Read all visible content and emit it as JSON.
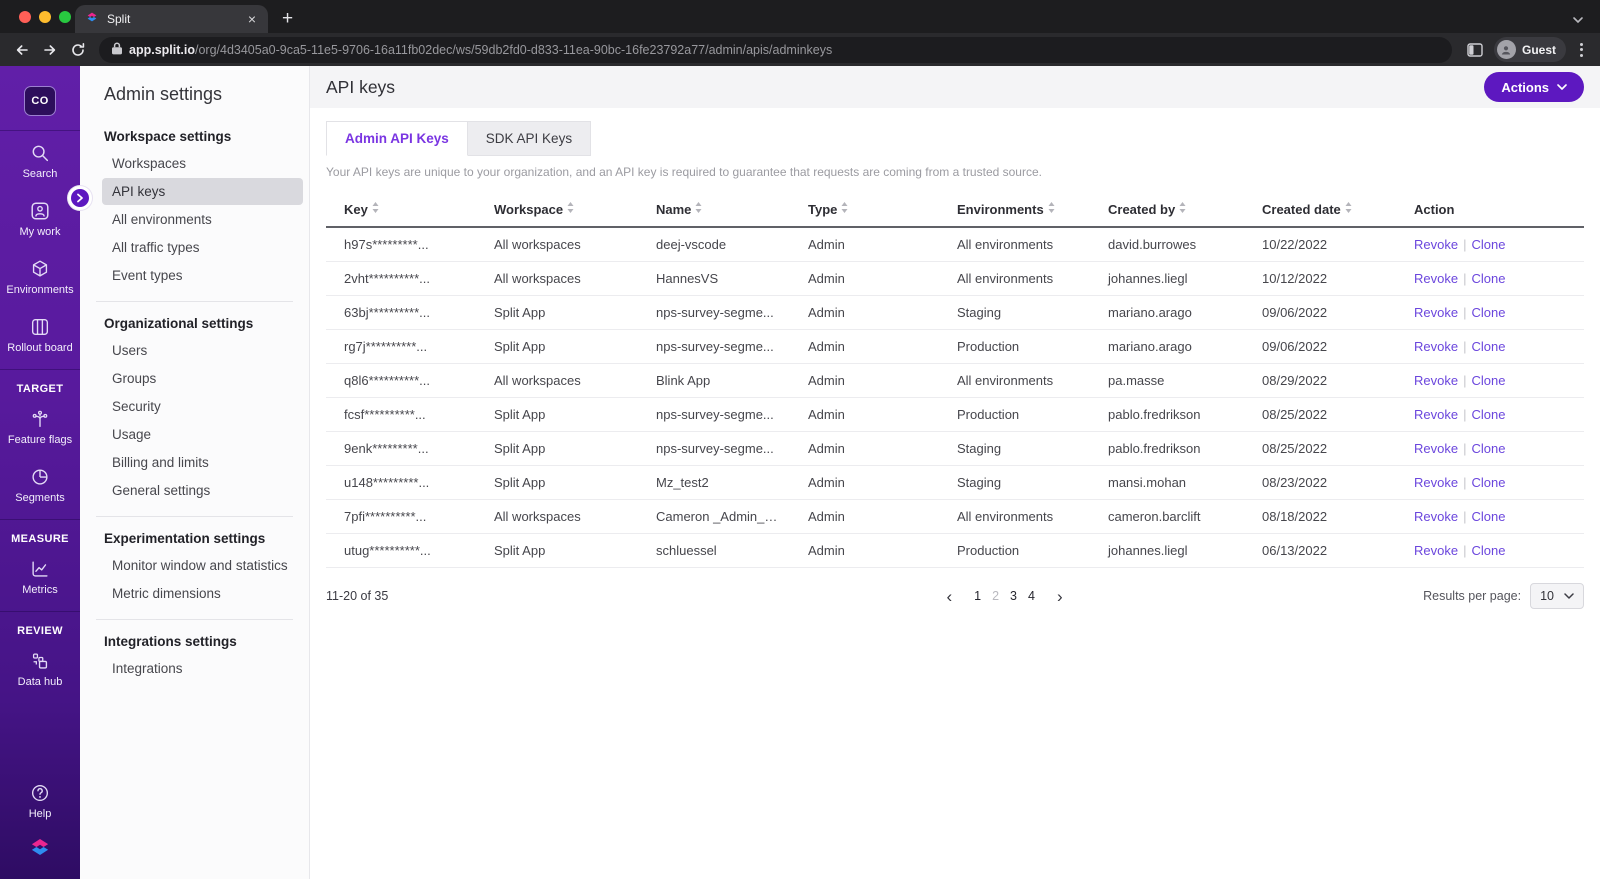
{
  "browser": {
    "tab": {
      "title": "Split"
    },
    "url": {
      "host": "app.split.io",
      "path": "/org/4d3405a0-9ca5-11e5-9706-16a11fb02dec/ws/59db2fd0-d833-11ea-90bc-16fe23792a77/admin/apis/adminkeys"
    },
    "profile": "Guest"
  },
  "rail": {
    "badge": "CO",
    "primary": [
      {
        "label": "Search",
        "icon": "search-icon"
      },
      {
        "label": "My work",
        "icon": "my-work-icon"
      },
      {
        "label": "Environments",
        "icon": "environments-icon"
      },
      {
        "label": "Rollout board",
        "icon": "rollout-board-icon"
      }
    ],
    "target_header": "TARGET",
    "target": [
      {
        "label": "Feature flags",
        "icon": "feature-flags-icon"
      },
      {
        "label": "Segments",
        "icon": "segments-icon"
      }
    ],
    "measure_header": "MEASURE",
    "measure": [
      {
        "label": "Metrics",
        "icon": "metrics-icon"
      }
    ],
    "review_header": "REVIEW",
    "review": [
      {
        "label": "Data hub",
        "icon": "data-hub-icon"
      }
    ],
    "help": "Help"
  },
  "subnav": {
    "title": "Admin settings",
    "sections": [
      {
        "header": "Workspace settings",
        "items": [
          {
            "label": "Workspaces"
          },
          {
            "label": "API keys",
            "active": true
          },
          {
            "label": "All environments"
          },
          {
            "label": "All traffic types"
          },
          {
            "label": "Event types"
          }
        ]
      },
      {
        "header": "Organizational settings",
        "items": [
          {
            "label": "Users"
          },
          {
            "label": "Groups"
          },
          {
            "label": "Security"
          },
          {
            "label": "Usage"
          },
          {
            "label": "Billing and limits"
          },
          {
            "label": "General settings"
          }
        ]
      },
      {
        "header": "Experimentation settings",
        "items": [
          {
            "label": "Monitor window and statistics"
          },
          {
            "label": "Metric dimensions"
          }
        ]
      },
      {
        "header": "Integrations settings",
        "items": [
          {
            "label": "Integrations"
          }
        ]
      }
    ]
  },
  "page": {
    "title": "API keys",
    "actions_label": "Actions",
    "tabs": [
      {
        "label": "Admin API Keys",
        "active": true
      },
      {
        "label": "SDK API Keys",
        "active": false
      }
    ],
    "description": "Your API keys are unique to your organization, and an API key is required to guarantee that requests are coming from a trusted source."
  },
  "table": {
    "columns": [
      {
        "label": "Key",
        "sortable": true
      },
      {
        "label": "Workspace",
        "sortable": true
      },
      {
        "label": "Name",
        "sortable": true
      },
      {
        "label": "Type",
        "sortable": true
      },
      {
        "label": "Environments",
        "sortable": true
      },
      {
        "label": "Created by",
        "sortable": true
      },
      {
        "label": "Created date",
        "sortable": true
      },
      {
        "label": "Action",
        "sortable": false
      }
    ],
    "action_labels": [
      "Revoke",
      "Clone"
    ],
    "action_separator": "|",
    "rows": [
      {
        "key": "h97s*********...",
        "workspace": "All workspaces",
        "name": "deej-vscode",
        "type": "Admin",
        "environments": "All environments",
        "created_by": "david.burrowes",
        "created_date": "10/22/2022"
      },
      {
        "key": "2vht**********...",
        "workspace": "All workspaces",
        "name": "HannesVS",
        "type": "Admin",
        "environments": "All environments",
        "created_by": "johannes.liegl",
        "created_date": "10/12/2022"
      },
      {
        "key": "63bj**********...",
        "workspace": "Split App",
        "name": "nps-survey-segme...",
        "type": "Admin",
        "environments": "Staging",
        "created_by": "mariano.arago",
        "created_date": "09/06/2022"
      },
      {
        "key": "rg7j**********...",
        "workspace": "Split App",
        "name": "nps-survey-segme...",
        "type": "Admin",
        "environments": "Production",
        "created_by": "mariano.arago",
        "created_date": "09/06/2022"
      },
      {
        "key": "q8l6**********...",
        "workspace": "All workspaces",
        "name": "Blink App",
        "type": "Admin",
        "environments": "All environments",
        "created_by": "pa.masse",
        "created_date": "08/29/2022"
      },
      {
        "key": "fcsf**********...",
        "workspace": "Split App",
        "name": "nps-survey-segme...",
        "type": "Admin",
        "environments": "Production",
        "created_by": "pablo.fredrikson",
        "created_date": "08/25/2022"
      },
      {
        "key": "9enk*********...",
        "workspace": "Split App",
        "name": "nps-survey-segme...",
        "type": "Admin",
        "environments": "Staging",
        "created_by": "pablo.fredrikson",
        "created_date": "08/25/2022"
      },
      {
        "key": "u148*********...",
        "workspace": "Split App",
        "name": "Mz_test2",
        "type": "Admin",
        "environments": "Staging",
        "created_by": "mansi.mohan",
        "created_date": "08/23/2022"
      },
      {
        "key": "7pfi**********...",
        "workspace": "All workspaces",
        "name": "Cameron _Admin_d...",
        "type": "Admin",
        "environments": "All environments",
        "created_by": "cameron.barclift",
        "created_date": "08/18/2022"
      },
      {
        "key": "utug**********...",
        "workspace": "Split App",
        "name": "schluessel",
        "type": "Admin",
        "environments": "Production",
        "created_by": "johannes.liegl",
        "created_date": "06/13/2022"
      }
    ]
  },
  "pagination": {
    "range": "11-20 of 35",
    "prev": "‹",
    "next": "›",
    "pages": [
      "1",
      "2",
      "3",
      "4"
    ],
    "current_page": "2",
    "results_per_page_label": "Results per page:",
    "results_per_page": "10"
  },
  "colors": {
    "brand_purple": "#5d18c0",
    "link_purple": "#6b46dd",
    "active_tab_purple": "#7a35e2",
    "rail_gradient_top": "#611fa8",
    "rail_gradient_bottom": "#2e0c63",
    "logo_magenta": "#ec268f",
    "logo_blue": "#2e8df0"
  }
}
